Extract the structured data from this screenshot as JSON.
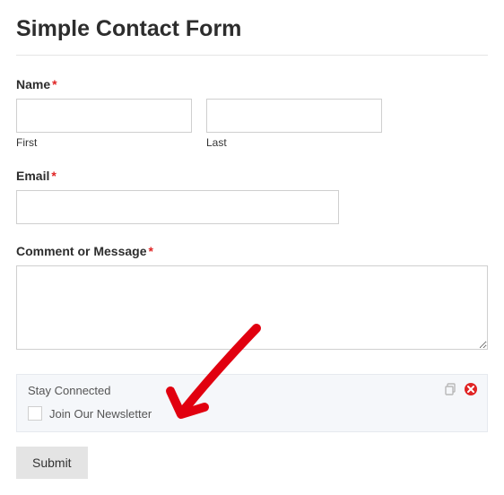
{
  "form": {
    "title": "Simple Contact Form",
    "name_label": "Name",
    "first_sublabel": "First",
    "last_sublabel": "Last",
    "email_label": "Email",
    "comment_label": "Comment or Message",
    "required_marker": "*"
  },
  "stay_connected": {
    "title": "Stay Connected",
    "option_label": "Join Our Newsletter"
  },
  "submit": {
    "label": "Submit"
  }
}
